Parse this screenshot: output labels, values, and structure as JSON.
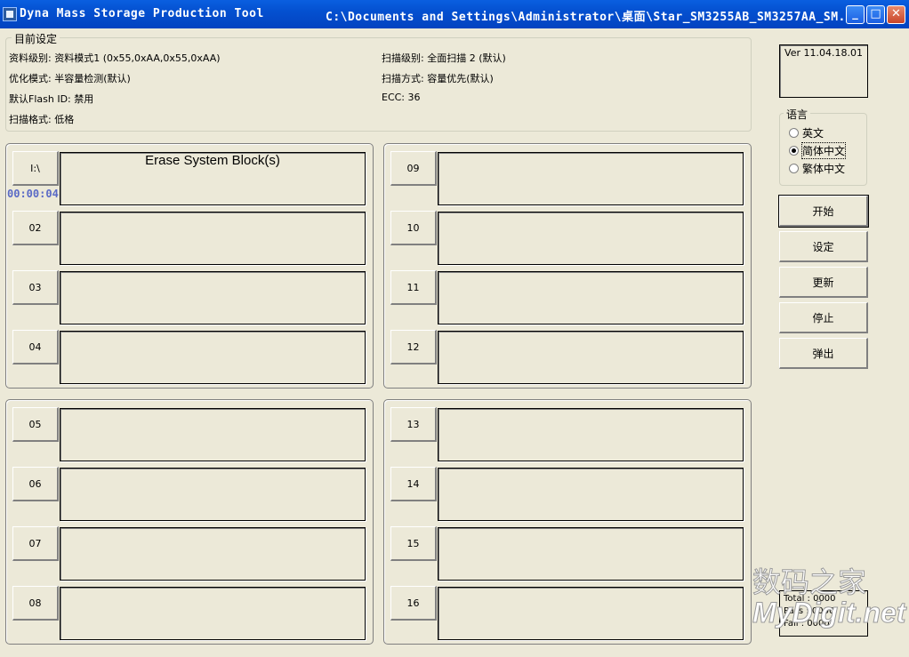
{
  "window": {
    "app_title": "Dyna Mass Storage Production Tool",
    "path_title": "C:\\Documents and Settings\\Administrator\\桌面\\Star_SM3255AB_SM3257AA_SM...",
    "min_glyph": "_",
    "max_glyph": "□",
    "close_glyph": "✕"
  },
  "settings": {
    "legend": "目前设定",
    "data_level": "资料级别: 资料模式1 (0x55,0xAA,0x55,0xAA)",
    "optimize_mode": "优化模式: 半容量检测(默认)",
    "default_flash_id": "默认Flash ID: 禁用",
    "scan_format": "扫描格式: 低格",
    "scan_level": "扫描级别: 全面扫描 2 (默认)",
    "scan_method": "扫描方式: 容量优先(默认)",
    "ecc": "ECC: 36"
  },
  "ports": [
    {
      "label": "I:\\",
      "status": "Erase System Block(s)",
      "timer": "00:00:04"
    },
    {
      "label": "02",
      "status": ""
    },
    {
      "label": "03",
      "status": ""
    },
    {
      "label": "04",
      "status": ""
    },
    {
      "label": "05",
      "status": ""
    },
    {
      "label": "06",
      "status": ""
    },
    {
      "label": "07",
      "status": ""
    },
    {
      "label": "08",
      "status": ""
    },
    {
      "label": "09",
      "status": ""
    },
    {
      "label": "10",
      "status": ""
    },
    {
      "label": "11",
      "status": ""
    },
    {
      "label": "12",
      "status": ""
    },
    {
      "label": "13",
      "status": ""
    },
    {
      "label": "14",
      "status": ""
    },
    {
      "label": "15",
      "status": ""
    },
    {
      "label": "16",
      "status": ""
    }
  ],
  "version": "Ver 11.04.18.01",
  "language": {
    "legend": "语言",
    "options": [
      "英文",
      "简体中文",
      "繁体中文"
    ],
    "selected": "简体中文"
  },
  "buttons": {
    "start": "开始",
    "settings": "设定",
    "update": "更新",
    "stop": "停止",
    "eject": "弹出"
  },
  "stats": {
    "total": "Total : 0000",
    "pass": "Pass : 0000",
    "fail": "Fail : 0000"
  },
  "watermark": {
    "line1": "数码之家",
    "line2": "MyDigit.net"
  }
}
